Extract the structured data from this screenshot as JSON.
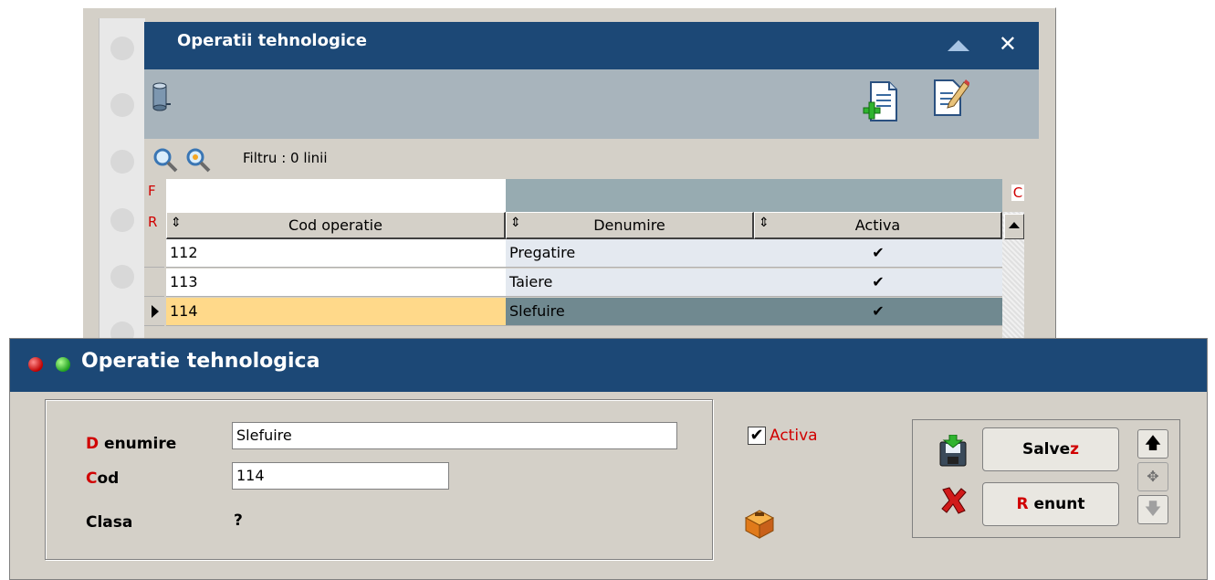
{
  "background_window": {
    "title": "Operatii tehnologice",
    "filter_text": "Filtru : 0 linii",
    "fr_markers": {
      "f": "F",
      "r": "R",
      "c": "C"
    },
    "columns": [
      "Cod operatie",
      "Denumire",
      "Activa"
    ],
    "sort_glyph": "⇕",
    "rows": [
      {
        "cod": "112",
        "denumire": "Pregatire",
        "activa": "✔"
      },
      {
        "cod": "113",
        "denumire": "Taiere",
        "activa": "✔"
      },
      {
        "cod": "114",
        "denumire": "Slefuire",
        "activa": "✔"
      }
    ]
  },
  "dialog": {
    "title": "Operatie tehnologica",
    "fields": {
      "denumire": {
        "hot": "D",
        "rest": "enumire",
        "value": "Slefuire"
      },
      "cod": {
        "hot": "C",
        "rest": "od",
        "value": "114"
      },
      "clasa": {
        "label": "Clasa",
        "value": "?"
      }
    },
    "activa": {
      "label": "Activa",
      "checked": true,
      "check_glyph": "✔"
    },
    "buttons": {
      "save": {
        "pre": "Salve",
        "hot": "z"
      },
      "cancel": {
        "hot": "R",
        "rest": "enunt"
      },
      "up_arrow": "🡅",
      "move": "✥",
      "down_arrow": "🡇"
    }
  },
  "colors": {
    "titlebar": "#1c4876",
    "selected_row_code": "#ffd98a",
    "selected_row_rest": "#708990",
    "hotkey_red": "#d00000"
  }
}
